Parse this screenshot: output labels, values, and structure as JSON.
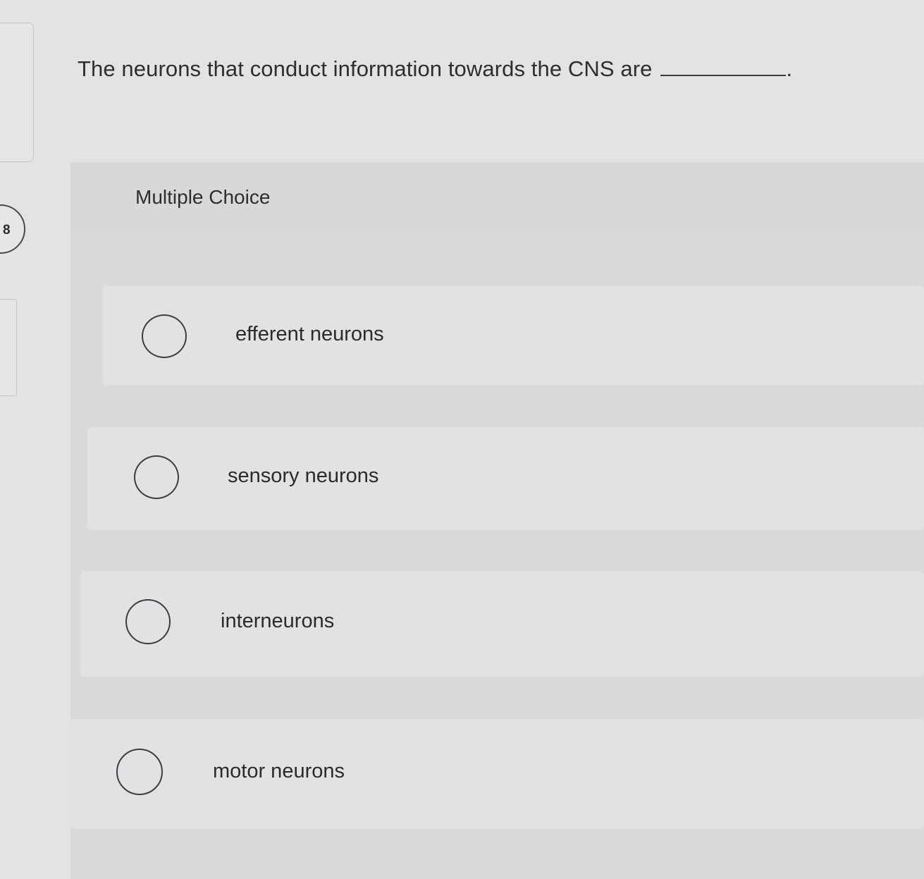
{
  "sidebar": {
    "question_number": "8"
  },
  "question": {
    "text": "The neurons that conduct information towards the CNS are",
    "terminal_punctuation": "."
  },
  "answer_panel": {
    "type_label": "Multiple Choice",
    "options": [
      {
        "label": "efferent neurons",
        "selected": false
      },
      {
        "label": "sensory neurons",
        "selected": false
      },
      {
        "label": "interneurons",
        "selected": false
      },
      {
        "label": "motor neurons",
        "selected": false
      }
    ]
  },
  "colors": {
    "background": "#e2e3e4",
    "panel": "#d9dadb",
    "option_row": "#e1e2e3",
    "text": "#2b2b2d",
    "radio_border": "#3c3d40"
  }
}
